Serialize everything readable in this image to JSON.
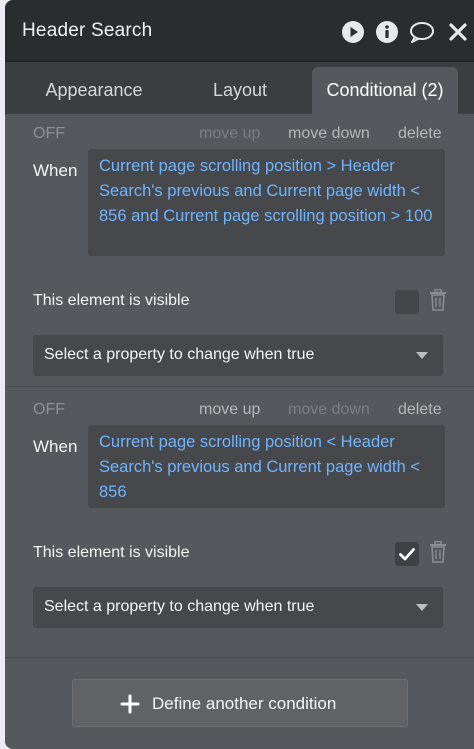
{
  "window": {
    "title": "Header Search",
    "icons": [
      "play-icon",
      "info-icon",
      "comment-icon",
      "close-icon"
    ]
  },
  "tabs": [
    {
      "label": "Appearance",
      "active": false
    },
    {
      "label": "Layout",
      "active": false
    },
    {
      "label": "Conditional (2)",
      "active": true
    }
  ],
  "conditions": [
    {
      "state": "OFF",
      "actions": {
        "move_up": "move up",
        "move_down": "move down",
        "delete": "delete"
      },
      "move_up_enabled": false,
      "move_down_enabled": true,
      "when_label": "When",
      "expression": "Current page scrolling position > Header Search's previous and Current page width < 856 and Current page scrolling position > 100",
      "property_label": "This element is visible",
      "property_checked": false,
      "select_placeholder": "Select a property to change when true"
    },
    {
      "state": "OFF",
      "actions": {
        "move_up": "move up",
        "move_down": "move down",
        "delete": "delete"
      },
      "move_up_enabled": true,
      "move_down_enabled": false,
      "when_label": "When",
      "expression": "Current page scrolling position < Header Search's previous and Current page width < 856",
      "property_label": "This element is visible",
      "property_checked": true,
      "select_placeholder": "Select a property to change when true"
    }
  ],
  "define_button": {
    "label": "Define another condition"
  },
  "colors": {
    "titlebar": "#2a2c2e",
    "panel": "#3b3e41",
    "content": "#55585c",
    "expression_text": "#6fb4ff"
  }
}
